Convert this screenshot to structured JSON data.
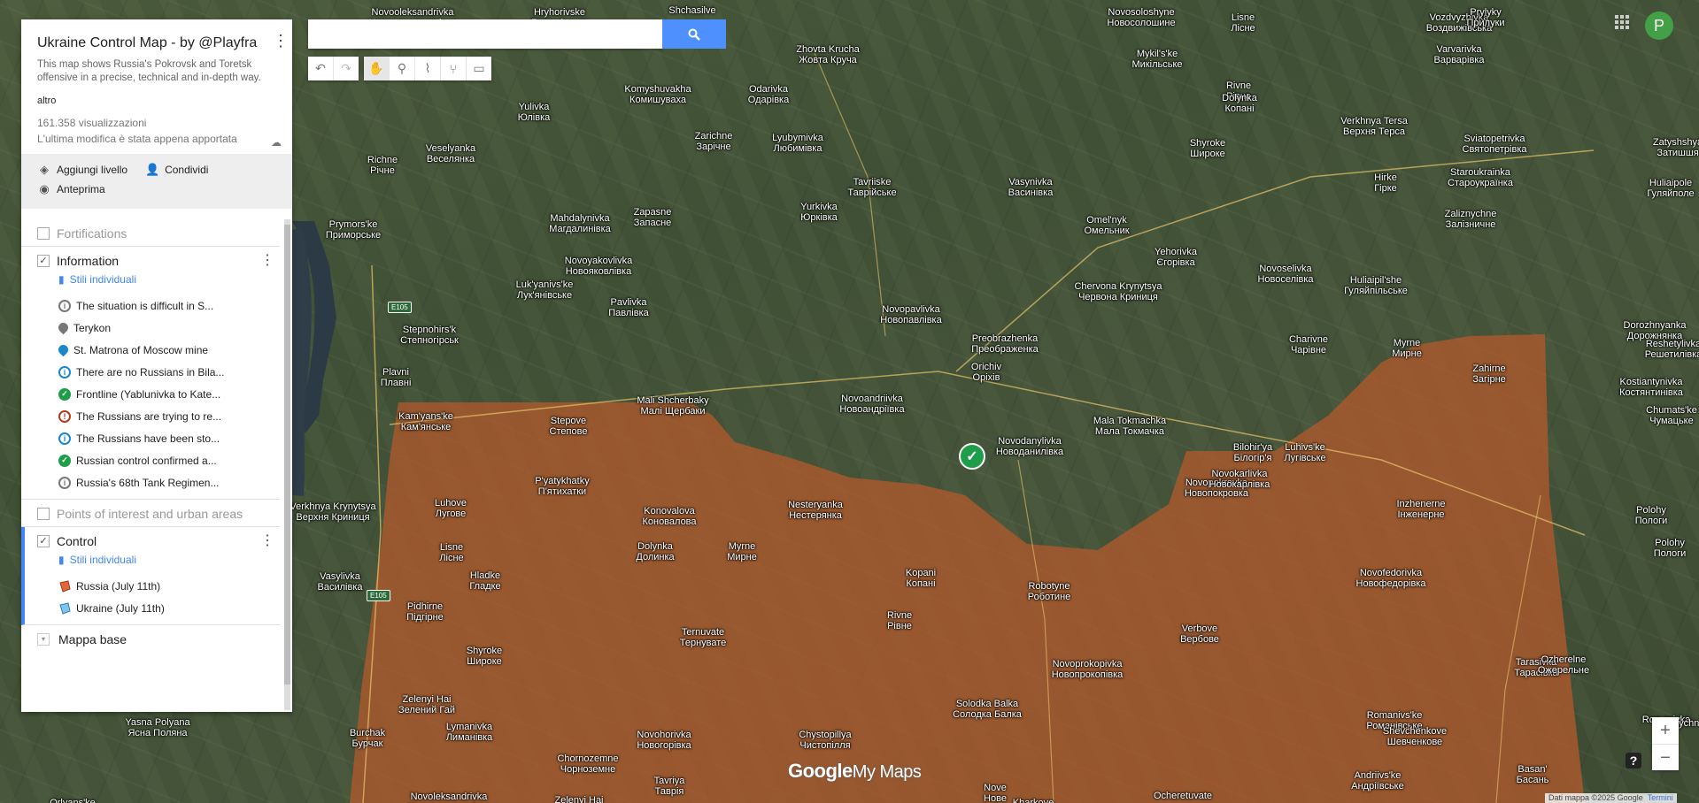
{
  "panel": {
    "title": "Ukraine Control Map - by @Playfra",
    "description": "This map shows Russia's Pokrovsk and Toretsk offensive in a precise, technical and in-depth way.",
    "more": "altro",
    "views": "161.358 visualizzazioni",
    "last_edit": "L'ultima modifica è stata appena apportata",
    "actions": {
      "add_layer": "Aggiungi livello",
      "share": "Condividi",
      "preview": "Anteprima"
    },
    "layers": {
      "fortifications": "Fortifications",
      "information": {
        "name": "Information",
        "styles": "Stili individuali",
        "items": [
          "The situation is difficult in S...",
          "Terykon",
          "St. Matrona of Moscow mine",
          "There are no Russians in Bila...",
          "Frontline (Yablunivka to Kate...",
          "The Russians are trying to re...",
          "The Russians have been sto...",
          "Russian control confirmed a...",
          "Russia's 68th Tank Regimen..."
        ]
      },
      "poi": "Points of interest and urban areas",
      "control": {
        "name": "Control",
        "styles": "Stili individuali",
        "items": [
          "Russia (July 11th)",
          "Ukraine (July 11th)"
        ]
      },
      "basemap": "Mappa base"
    }
  },
  "search": {
    "placeholder": ""
  },
  "user": {
    "initial": "P"
  },
  "map": {
    "logo_google": "Google",
    "logo_mymaps": "My Maps",
    "attribution": "Dati mappa ©2025 Google",
    "terms": "Termini",
    "zoom_in": "+",
    "zoom_out": "−",
    "road_e105_a": "E105",
    "road_e105_b": "E105",
    "places": [
      {
        "n1": "Novooleksandrivka",
        "n2": "Новоолександрівка"
      },
      {
        "n1": "Hryhorivske",
        "n2": "Григорівське"
      },
      {
        "n1": "Shchasilve",
        "n2": ""
      },
      {
        "n1": "Novosoloshyne",
        "n2": "Новосолошине"
      },
      {
        "n1": "Lisne",
        "n2": "Лісне"
      },
      {
        "n1": "Vozdvyzhivka",
        "n2": "Воздвижівська"
      },
      {
        "n1": "Prylyky",
        "n2": "Прилуки"
      },
      {
        "n1": "Zhovta Krucha",
        "n2": "Жовта Круча"
      },
      {
        "n1": "Mykil's'ke",
        "n2": "Микільське"
      },
      {
        "n1": "Varvarivka",
        "n2": "Варварівка"
      },
      {
        "n1": "Komyshuvakha",
        "n2": "Комишуваха"
      },
      {
        "n1": "Odarivka",
        "n2": "Одарівка"
      },
      {
        "n1": "Rivne",
        "n2": "Рівне"
      },
      {
        "n1": "Yulivka",
        "n2": "Юлівка"
      },
      {
        "n1": "Dolynka",
        "n2": "Копані"
      },
      {
        "n1": "Verkhnya Tersa",
        "n2": "Верхня Терса"
      },
      {
        "n1": "Sviatopetrivka",
        "n2": "Святопетрівка"
      },
      {
        "n1": "Zatyshshya",
        "n2": "Затишшя"
      },
      {
        "n1": "Veselyanka",
        "n2": "Веселянка"
      },
      {
        "n1": "Zarichne",
        "n2": "Зарічне"
      },
      {
        "n1": "Lyubymivka",
        "n2": "Любимівка"
      },
      {
        "n1": "Shyroke",
        "n2": "Широке"
      },
      {
        "n1": "Richne",
        "n2": "Річне"
      },
      {
        "n1": "Tavriiske",
        "n2": "Таврійське"
      },
      {
        "n1": "Vasynivka",
        "n2": "Васинівка"
      },
      {
        "n1": "Hirke",
        "n2": "Гірке"
      },
      {
        "n1": "Staroukrainka",
        "n2": "Староукраїнка"
      },
      {
        "n1": "Huliaipole",
        "n2": "Гуляйполе"
      },
      {
        "n1": "Yurkivka",
        "n2": "Юрківка"
      },
      {
        "n1": "Zapasne",
        "n2": "Запасне"
      },
      {
        "n1": "Mahdalynivka",
        "n2": "Магдалинівка"
      },
      {
        "n1": "Omel'nyk",
        "n2": "Омельник"
      },
      {
        "n1": "Zaliznychne",
        "n2": "Залізничне"
      },
      {
        "n1": "Prymors'ke",
        "n2": "Приморське"
      },
      {
        "n1": "Yehorivka",
        "n2": "Єгорівка"
      },
      {
        "n1": "Novoyakovlivka",
        "n2": "Новояковлівка"
      },
      {
        "n1": "Novoselivka",
        "n2": "Новоселівка"
      },
      {
        "n1": "Huliaipil'she",
        "n2": "Гуляйпільське"
      },
      {
        "n1": "Luk'yanivs'ke",
        "n2": "Лук'янівське"
      },
      {
        "n1": "Chervona Krynytsya",
        "n2": "Червона Криниця"
      },
      {
        "n1": "Pavlivka",
        "n2": "Павлівка"
      },
      {
        "n1": "Novopavlivka",
        "n2": "Новопавлівка"
      },
      {
        "n1": "Stepnohirs'k",
        "n2": "Степногірськ"
      },
      {
        "n1": "Dorozhnyanka",
        "n2": "Дорожнянка"
      },
      {
        "n1": "Preobrazhenka",
        "n2": "Преображенка"
      },
      {
        "n1": "Charivne",
        "n2": "Чарівне"
      },
      {
        "n1": "Myrne",
        "n2": "Мирне"
      },
      {
        "n1": "Reshetylivka",
        "n2": "Решетилівка"
      },
      {
        "n1": "Zahirne",
        "n2": "Загірне"
      },
      {
        "n1": "Orichiv",
        "n2": "Оріхів"
      },
      {
        "n1": "Kostiantynivka",
        "n2": "Костянтинівка"
      },
      {
        "n1": "Plavni",
        "n2": "Плавні"
      },
      {
        "n1": "Mali Shcherbaky",
        "n2": "Малі Щербаки"
      },
      {
        "n1": "Novoandriivka",
        "n2": "Новоандріївка"
      },
      {
        "n1": "Chumats'ke",
        "n2": "Чумацьке"
      },
      {
        "n1": "Kam'yans'ke",
        "n2": "Кам'янське"
      },
      {
        "n1": "Stepove",
        "n2": "Степове"
      },
      {
        "n1": "Mala Tokmachka",
        "n2": "Мала Токмачка"
      },
      {
        "n1": "Bilohir'ya",
        "n2": "Білогір'я"
      },
      {
        "n1": "Luhivs'ke",
        "n2": "Лугівське"
      },
      {
        "n1": "Novodanylivka",
        "n2": "Новоданилівка"
      },
      {
        "n1": "Novopokrovka",
        "n2": "Новопокровка"
      },
      {
        "n1": "Novokarlivka",
        "n2": "Новокарлівка"
      },
      {
        "n1": "P'yatykhatky",
        "n2": "П'ятихатки"
      },
      {
        "n1": "Inzhenerne",
        "n2": "Інженерне"
      },
      {
        "n1": "Polohy",
        "n2": "Пологи"
      },
      {
        "n1": "Verkhnya Krynytsya",
        "n2": "Верхня Криниця"
      },
      {
        "n1": "Luhove",
        "n2": "Лугове"
      },
      {
        "n1": "Nesteryanka",
        "n2": "Нестерянка"
      },
      {
        "n1": "Konovalova",
        "n2": "Коновалова"
      },
      {
        "n1": "Dolynka",
        "n2": "Долинка"
      },
      {
        "n1": "Myrne",
        "n2": "Мирне"
      },
      {
        "n1": "Polohy",
        "n2": "Пологи"
      },
      {
        "n1": "Lisne",
        "n2": "Лісне"
      },
      {
        "n1": "Hladke",
        "n2": "Гладке"
      },
      {
        "n1": "Kopani",
        "n2": "Копані"
      },
      {
        "n1": "Robotyne",
        "n2": "Роботине"
      },
      {
        "n1": "Novofedorivka",
        "n2": "Новофедорівка"
      },
      {
        "n1": "Vasylivka",
        "n2": "Василівка"
      },
      {
        "n1": "Pidhirne",
        "n2": "Підгірне"
      },
      {
        "n1": "Rivne",
        "n2": "Рівне"
      },
      {
        "n1": "Verbove",
        "n2": "Вербове"
      },
      {
        "n1": "Ternuvate",
        "n2": "Тернувате"
      },
      {
        "n1": "Shyroke",
        "n2": "Широке"
      },
      {
        "n1": "Novoprokopivka",
        "n2": "Новопрокопівка"
      },
      {
        "n1": "Tarasivka",
        "n2": "Тарасівка"
      },
      {
        "n1": "Ozherelne",
        "n2": "Ожерельне"
      },
      {
        "n1": "Zelenyi Hai",
        "n2": "Зелений Гай"
      },
      {
        "n1": "Solodka Balka",
        "n2": "Солодка Балка"
      },
      {
        "n1": "Burchak",
        "n2": "Бурчак"
      },
      {
        "n1": "Lymanivka",
        "n2": "Лиманівка"
      },
      {
        "n1": "Novohorivka",
        "n2": "Новогорівка"
      },
      {
        "n1": "Chystopillya",
        "n2": "Чистопілля"
      },
      {
        "n1": "Romanivs'ke",
        "n2": "Романівське"
      },
      {
        "n1": "Shevchenkove",
        "n2": "Шевченкове"
      },
      {
        "n1": "Yasna Polyana",
        "n2": "Ясна Поляна"
      },
      {
        "n1": "Chornozemne",
        "n2": "Чорноземне"
      },
      {
        "n1": "Tavriya",
        "n2": "Таврія"
      },
      {
        "n1": "Nove",
        "n2": "Нове"
      },
      {
        "n1": "Andriivs'ke",
        "n2": "Андріївське"
      },
      {
        "n1": "Basan'",
        "n2": "Басань"
      },
      {
        "n1": "Orlyans'ke",
        "n2": ""
      },
      {
        "n1": "Novoleksandrivka",
        "n2": "Новолександрівка"
      },
      {
        "n1": "Zelenyi Hai",
        "n2": ""
      },
      {
        "n1": "Kharkove",
        "n2": ""
      },
      {
        "n1": "Ocheretuvate",
        "n2": ""
      },
      {
        "n1": "Rozumivka",
        "n2": ""
      },
      {
        "n1": "Zaterychne",
        "n2": ""
      }
    ]
  },
  "colors": {
    "russia_control": "#b45a2c",
    "accent": "#4285f4",
    "check_marker": "#1e9e4a"
  }
}
